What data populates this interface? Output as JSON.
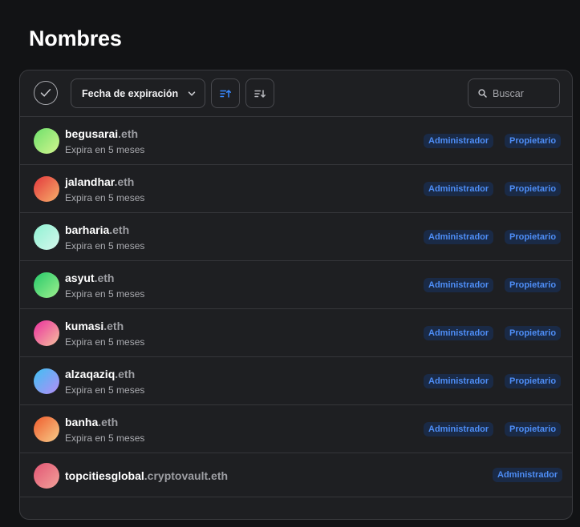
{
  "page": {
    "title": "Nombres"
  },
  "toolbar": {
    "sort_label": "Fecha de expiración",
    "search_placeholder": "Buscar"
  },
  "rows": [
    {
      "label": "begusarai",
      "suffix": ".eth",
      "expiry": "Expira en 5 meses",
      "admin": "Administrador",
      "owner": "Propietario"
    },
    {
      "label": "jalandhar",
      "suffix": ".eth",
      "expiry": "Expira en 5 meses",
      "admin": "Administrador",
      "owner": "Propietario"
    },
    {
      "label": "barharia",
      "suffix": ".eth",
      "expiry": "Expira en 5 meses",
      "admin": "Administrador",
      "owner": "Propietario"
    },
    {
      "label": "asyut",
      "suffix": ".eth",
      "expiry": "Expira en 5 meses",
      "admin": "Administrador",
      "owner": "Propietario"
    },
    {
      "label": "kumasi",
      "suffix": ".eth",
      "expiry": "Expira en 5 meses",
      "admin": "Administrador",
      "owner": "Propietario"
    },
    {
      "label": "alzaqaziq",
      "suffix": ".eth",
      "expiry": "Expira en 5 meses",
      "admin": "Administrador",
      "owner": "Propietario"
    },
    {
      "label": "banha",
      "suffix": ".eth",
      "expiry": "Expira en 5 meses",
      "admin": "Administrador",
      "owner": "Propietario"
    },
    {
      "label": "topcitiesglobal",
      "suffix": ".cryptovault.eth",
      "admin": "Administrador"
    }
  ],
  "colors": {
    "background": "#121315",
    "card": "#1e1f22",
    "badge_bg": "#1a2a46",
    "badge_text": "#4e8ef7",
    "accent": "#3889ff"
  }
}
